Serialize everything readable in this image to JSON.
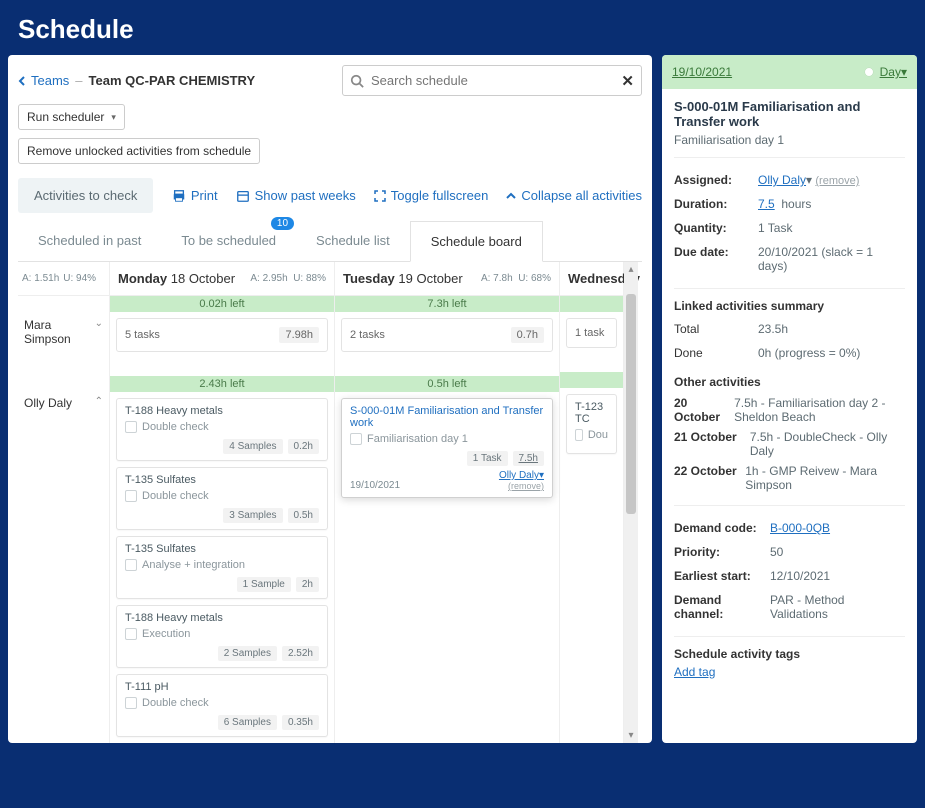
{
  "page": {
    "title": "Schedule"
  },
  "breadcrumb": {
    "teams": "Teams",
    "team_name": "Team QC-PAR CHEMISTRY"
  },
  "buttons": {
    "run_scheduler": "Run scheduler",
    "remove_unlocked": "Remove unlocked activities from schedule"
  },
  "search": {
    "placeholder": "Search schedule"
  },
  "toolbar": {
    "activities_to_check": "Activities to check",
    "print": "Print",
    "show_past_weeks": "Show past weeks",
    "toggle_fullscreen": "Toggle fullscreen",
    "collapse_all": "Collapse all activities"
  },
  "tabs": {
    "scheduled_in_past": "Scheduled in past",
    "to_be_scheduled": "To be scheduled",
    "to_be_scheduled_badge": "10",
    "schedule_list": "Schedule list",
    "schedule_board": "Schedule board"
  },
  "board": {
    "summary": {
      "a": "A: 1.51h",
      "u": "U: 94%"
    },
    "people": [
      {
        "name": "Mara Simpson",
        "expanded": false
      },
      {
        "name": "Olly Daly",
        "expanded": true
      }
    ],
    "days": [
      {
        "label_prefix": "Monday",
        "label_date": "18 October",
        "stat_a": "A: 2.95h",
        "stat_u": "U: 88%",
        "rows": [
          {
            "greenbar": "0.02h left",
            "summary": {
              "tasks": "5 tasks",
              "hours": "7.98h"
            }
          },
          {
            "greenbar": "2.43h left",
            "cards": [
              {
                "title": "T-188 Heavy metals",
                "sub": "Double check",
                "pill1": "4 Samples",
                "pill2": "0.2h"
              },
              {
                "title": "T-135 Sulfates",
                "sub": "Double check",
                "pill1": "3 Samples",
                "pill2": "0.5h"
              },
              {
                "title": "T-135 Sulfates",
                "sub": "Analyse + integration",
                "pill1": "1 Sample",
                "pill2": "2h"
              },
              {
                "title": "T-188 Heavy metals",
                "sub": "Execution",
                "pill1": "2 Samples",
                "pill2": "2.52h"
              },
              {
                "title": "T-111 pH",
                "sub": "Double check",
                "pill1": "6 Samples",
                "pill2": "0.35h"
              }
            ]
          }
        ]
      },
      {
        "label_prefix": "Tuesday",
        "label_date": "19 October",
        "stat_a": "A: 7.8h",
        "stat_u": "U: 68%",
        "rows": [
          {
            "greenbar": "7.3h left",
            "summary": {
              "tasks": "2 tasks",
              "hours": "0.7h"
            }
          },
          {
            "greenbar": "0.5h left",
            "cards_selected": {
              "title": "S-000-01M Familiarisation and Transfer work",
              "sub": "Familiarisation day 1",
              "pill1": "1 Task",
              "pill2": "7.5h",
              "date": "19/10/2021",
              "assignee": "Olly Daly",
              "remove": "(remove)"
            }
          }
        ]
      },
      {
        "label_prefix": "Wednesday",
        "label_date": "",
        "rows": [
          {
            "summary": {
              "tasks": "1 task"
            }
          },
          {
            "cards": [
              {
                "title": "T-123 TC",
                "sub": "Dou"
              }
            ]
          }
        ]
      }
    ]
  },
  "detail": {
    "date": "19/10/2021",
    "period": "Day",
    "title": "S-000-01M Familiarisation and Transfer work",
    "subtitle": "Familiarisation day 1",
    "assigned_label": "Assigned:",
    "assigned_value": "Olly Daly",
    "assigned_remove": "(remove)",
    "duration_label": "Duration:",
    "duration_value": "7.5",
    "duration_unit": "hours",
    "quantity_label": "Quantity:",
    "quantity_value": "1 Task",
    "due_label": "Due date:",
    "due_value": "20/10/2021 (slack = 1 days)",
    "linked_title": "Linked activities summary",
    "total_label": "Total",
    "total_value": "23.5h",
    "done_label": "Done",
    "done_value": "0h (progress = 0%)",
    "other_title": "Other activities",
    "other": [
      {
        "date": "20 October",
        "text": "7.5h - Familiarisation day 2 - Sheldon Beach"
      },
      {
        "date": "21 October",
        "text": "7.5h - DoubleCheck - Olly Daly"
      },
      {
        "date": "22 October",
        "text": "1h - GMP Reivew - Mara Simpson"
      }
    ],
    "demand_code_label": "Demand code:",
    "demand_code_value": "B-000-0QB",
    "priority_label": "Priority:",
    "priority_value": "50",
    "earliest_label": "Earliest start:",
    "earliest_value": "12/10/2021",
    "channel_label": "Demand channel:",
    "channel_value": "PAR - Method Validations",
    "tags_title": "Schedule activity tags",
    "add_tag": "Add tag"
  }
}
